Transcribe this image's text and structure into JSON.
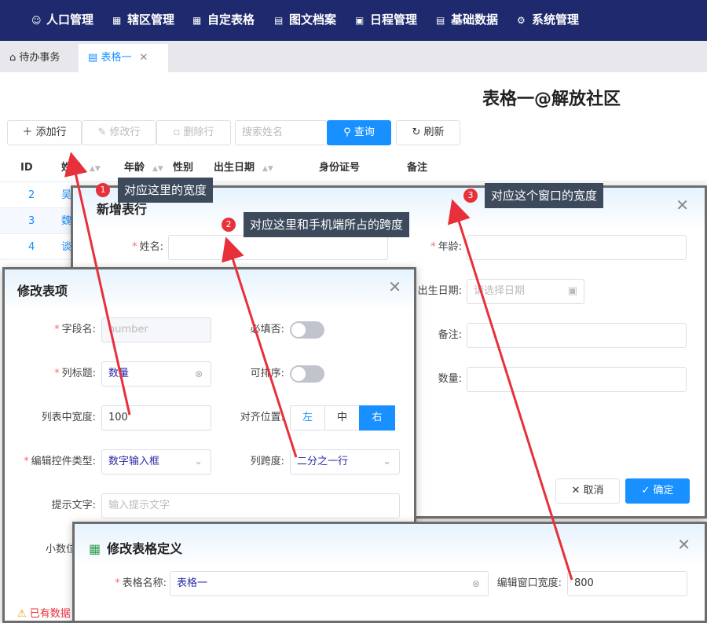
{
  "nav": {
    "items": [
      {
        "label": "人口管理",
        "icon": "user-icon"
      },
      {
        "label": "辖区管理",
        "icon": "building-icon"
      },
      {
        "label": "自定表格",
        "icon": "table-icon"
      },
      {
        "label": "图文档案",
        "icon": "document-icon"
      },
      {
        "label": "日程管理",
        "icon": "calendar-icon"
      },
      {
        "label": "基础数据",
        "icon": "database-icon"
      },
      {
        "label": "系统管理",
        "icon": "gear-icon"
      }
    ]
  },
  "tabs": [
    {
      "label": "待办事务",
      "icon": "home-icon"
    },
    {
      "label": "表格一",
      "icon": "form-icon"
    }
  ],
  "page": {
    "title": "表格一@解放社区"
  },
  "toolbar": {
    "add": "添加行",
    "edit": "修改行",
    "delete": "删除行",
    "search_placeholder": "搜索姓名",
    "query": "查询",
    "refresh": "刷新"
  },
  "table": {
    "headers": [
      "ID",
      "姓名",
      "年龄",
      "性别",
      "出生日期",
      "身份证号",
      "备注"
    ],
    "rows": [
      {
        "id": "2",
        "name": "吴"
      },
      {
        "id": "3",
        "name": "魏"
      },
      {
        "id": "4",
        "name": "谈"
      }
    ]
  },
  "add_dialog": {
    "title": "新增表行",
    "name_label": "姓名:",
    "age_label": "年龄:",
    "birth_label": "出生日期:",
    "birth_placeholder": "请选择日期",
    "remark_label": "备注:",
    "qty_label": "数量:",
    "cancel": "取消",
    "confirm": "确定"
  },
  "edit_field_dialog": {
    "title": "修改表项",
    "field_label": "字段名:",
    "field_value": "number",
    "col_title_label": "列标题:",
    "col_title_value": "数量",
    "required_label": "必填否:",
    "sortable_label": "可排序:",
    "width_label": "列表中宽度:",
    "width_value": "100",
    "align_label": "对齐位置:",
    "align_options": [
      "左",
      "中",
      "右"
    ],
    "control_label": "编辑控件类型:",
    "control_value": "数字输入框",
    "span_label": "列跨度:",
    "span_value": "二分之一行",
    "hint_label": "提示文字:",
    "hint_placeholder": "输入提示文字",
    "decimal_label": "小数位"
  },
  "table_def_dialog": {
    "title": "修改表格定义",
    "name_label": "表格名称:",
    "name_value": "表格一",
    "width_label": "编辑窗口宽度:",
    "width_value": "800"
  },
  "callouts": [
    {
      "num": "1",
      "text": "对应这里的宽度"
    },
    {
      "num": "2",
      "text": "对应这里和手机端所占的跨度"
    },
    {
      "num": "3",
      "text": "对应这个窗口的宽度"
    }
  ],
  "warning": "已有数据",
  "colors": {
    "nav": "#1e2a6d",
    "primary": "#1890ff",
    "callout": "#3c4a5c",
    "badge": "#e8303a",
    "arrow": "#e8303a"
  }
}
